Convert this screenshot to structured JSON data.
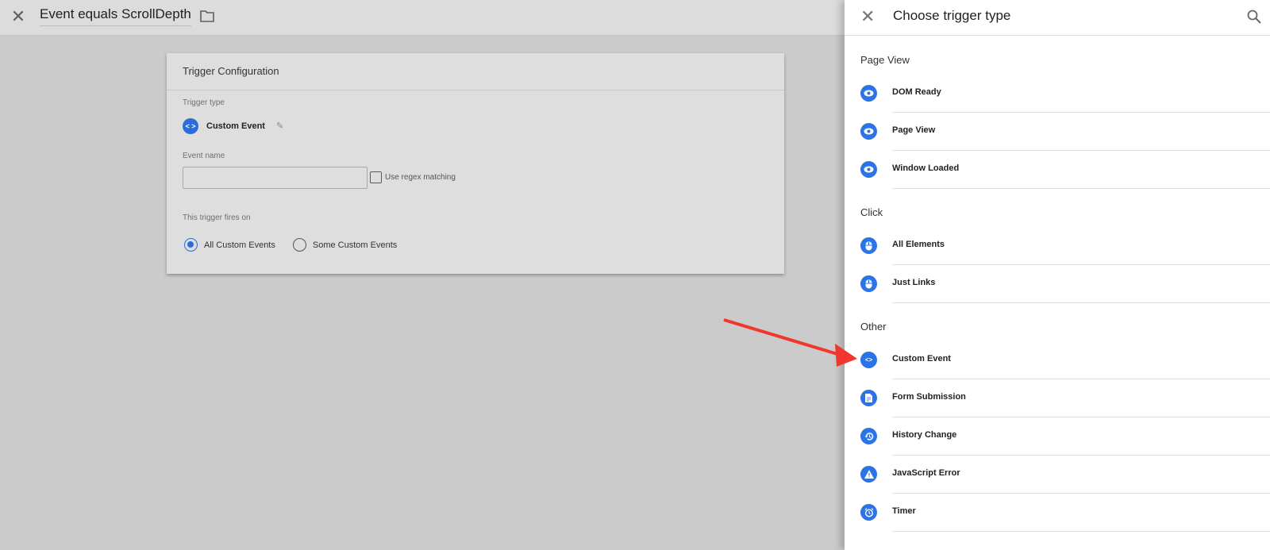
{
  "topbar": {
    "title": "Event equals ScrollDepth",
    "close_icon": "close-icon",
    "folder_icon": "folder-icon"
  },
  "card": {
    "header": "Trigger Configuration",
    "trigger_type_label": "Trigger type",
    "trigger_type_value": "Custom Event",
    "trigger_type_icon": "code-icon",
    "event_name_label": "Event name",
    "event_name_value": "",
    "event_name_placeholder": "",
    "regex_label": "Use regex matching",
    "regex_checked": false,
    "fires_on_label": "This trigger fires on",
    "fires_on_options": [
      {
        "label": "All Custom Events",
        "selected": true
      },
      {
        "label": "Some Custom Events",
        "selected": false
      }
    ]
  },
  "panel": {
    "title": "Choose trigger type",
    "sections": [
      {
        "name": "Page View",
        "items": [
          {
            "label": "DOM Ready",
            "icon": "eye-icon"
          },
          {
            "label": "Page View",
            "icon": "eye-icon"
          },
          {
            "label": "Window Loaded",
            "icon": "eye-icon"
          }
        ]
      },
      {
        "name": "Click",
        "items": [
          {
            "label": "All Elements",
            "icon": "mouse-icon"
          },
          {
            "label": "Just Links",
            "icon": "mouse-icon"
          }
        ]
      },
      {
        "name": "Other",
        "items": [
          {
            "label": "Custom Event",
            "icon": "code-icon"
          },
          {
            "label": "Form Submission",
            "icon": "document-icon"
          },
          {
            "label": "History Change",
            "icon": "history-icon"
          },
          {
            "label": "JavaScript Error",
            "icon": "warning-icon"
          },
          {
            "label": "Timer",
            "icon": "alarm-icon"
          }
        ]
      }
    ]
  },
  "annotation": {
    "color": "#f0362d",
    "points_to": "Custom Event"
  },
  "colors": {
    "accent": "#2a74e8"
  }
}
